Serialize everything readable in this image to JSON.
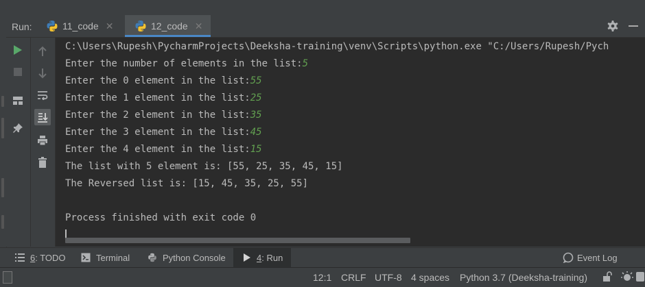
{
  "run": {
    "label": "Run:",
    "tabs": [
      {
        "label": "11_code",
        "active": false
      },
      {
        "label": "12_code",
        "active": true
      }
    ]
  },
  "console": {
    "lines": [
      {
        "text": "C:\\Users\\Rupesh\\PycharmProjects\\Deeksha-training\\venv\\Scripts\\python.exe \"C:/Users/Rupesh/Pych",
        "input": ""
      },
      {
        "text": "Enter the number of elements in the list:",
        "input": "5"
      },
      {
        "text": "Enter the 0 element in the list:",
        "input": "55"
      },
      {
        "text": "Enter the 1 element in the list:",
        "input": "25"
      },
      {
        "text": "Enter the 2 element in the list:",
        "input": "35"
      },
      {
        "text": "Enter the 3 element in the list:",
        "input": "45"
      },
      {
        "text": "Enter the 4 element in the list:",
        "input": "15"
      },
      {
        "text": "The list with 5 element is: [55, 25, 35, 45, 15]",
        "input": ""
      },
      {
        "text": "The Reversed list is: [15, 45, 35, 25, 55]",
        "input": ""
      },
      {
        "text": "",
        "input": ""
      },
      {
        "text": "Process finished with exit code 0",
        "input": ""
      }
    ]
  },
  "toolwindows": {
    "todo_num": "6",
    "todo_label": ": TODO",
    "terminal": "Terminal",
    "python_console": "Python Console",
    "run_num": "4",
    "run_label": ": Run",
    "event_log": "Event Log"
  },
  "status": {
    "position": "12:1",
    "line_sep": "CRLF",
    "encoding": "UTF-8",
    "indent": "4 spaces",
    "interpreter": "Python 3.7 (Deeksha-training)"
  },
  "colors": {
    "console_bg": "#2b2b2b",
    "input_text": "#62a050",
    "run_icon": "#59a869",
    "accent": "#4a88c7"
  }
}
